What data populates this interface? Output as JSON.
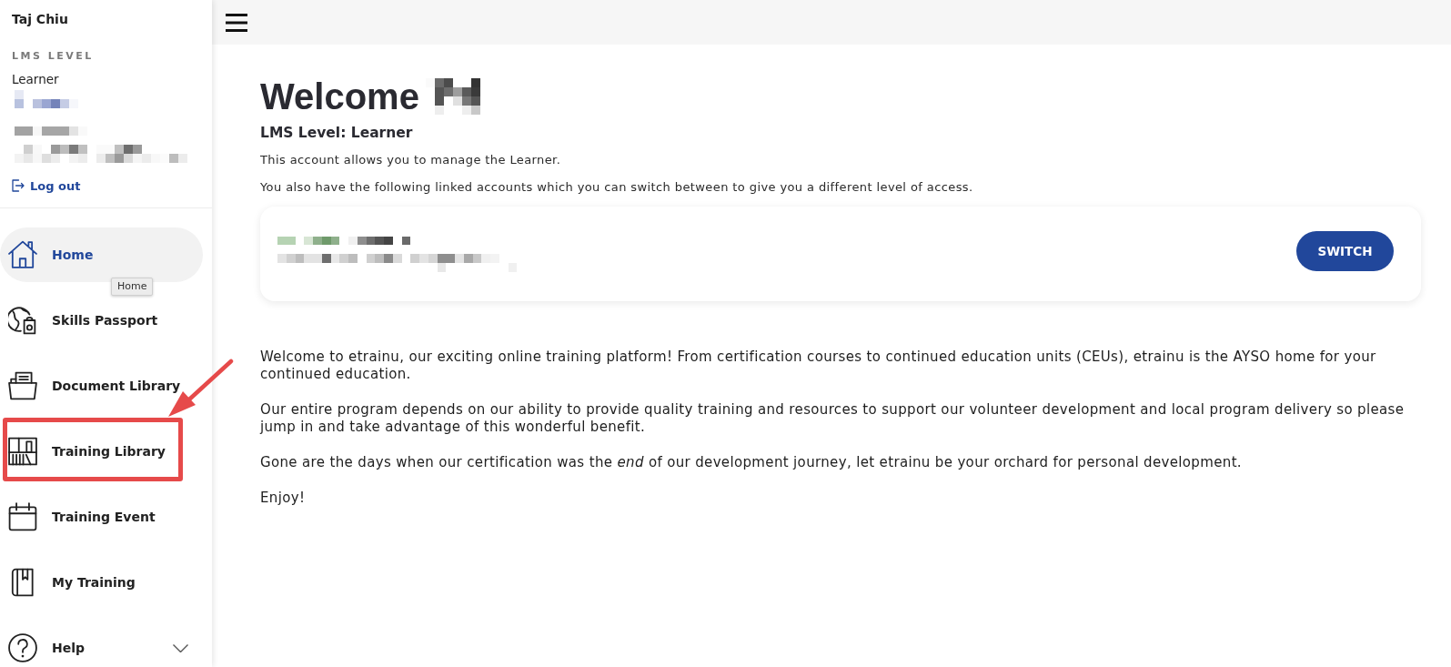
{
  "sidebar": {
    "user_name": "Taj Chiu",
    "level_label": "LMS LEVEL",
    "level_value": "Learner",
    "logout": "Log out",
    "nav_items": [
      {
        "kind": "home",
        "label": "Home",
        "selected": true,
        "highlighted": false,
        "tooltip": "Home"
      },
      {
        "kind": "passport",
        "label": "Skills Passport",
        "selected": false,
        "highlighted": false
      },
      {
        "kind": "documents",
        "label": "Document Library",
        "selected": false,
        "highlighted": false
      },
      {
        "kind": "library",
        "label": "Training Library",
        "selected": false,
        "highlighted": true
      },
      {
        "kind": "event",
        "label": "Training Event",
        "selected": false,
        "highlighted": false
      },
      {
        "kind": "training",
        "label": "My Training",
        "selected": false,
        "highlighted": false
      },
      {
        "kind": "help",
        "label": "Help",
        "selected": false,
        "highlighted": false,
        "expanded": false
      }
    ]
  },
  "main": {
    "title": "Welcome",
    "level_heading": "LMS Level: Learner",
    "intro": "This account allows you to manage the Learner.",
    "linked_note": "You also have the following linked accounts which you can switch between to give you a different level of access.",
    "linked_accounts": [
      {
        "button": "SWITCH"
      }
    ],
    "body_paragraphs": [
      "Welcome to etrainu, our exciting online training platform! From certification courses to continued education units (CEUs), etrainu is the AYSO home for your continued education.",
      "Our entire program depends on our ability to provide quality training and resources to support our volunteer development and local program delivery so please jump in and take advantage of this wonderful benefit.",
      "Gone are the days when our certification was the *end* of our development journey, let etrainu be your orchard for personal development.",
      "Enjoy!"
    ]
  }
}
